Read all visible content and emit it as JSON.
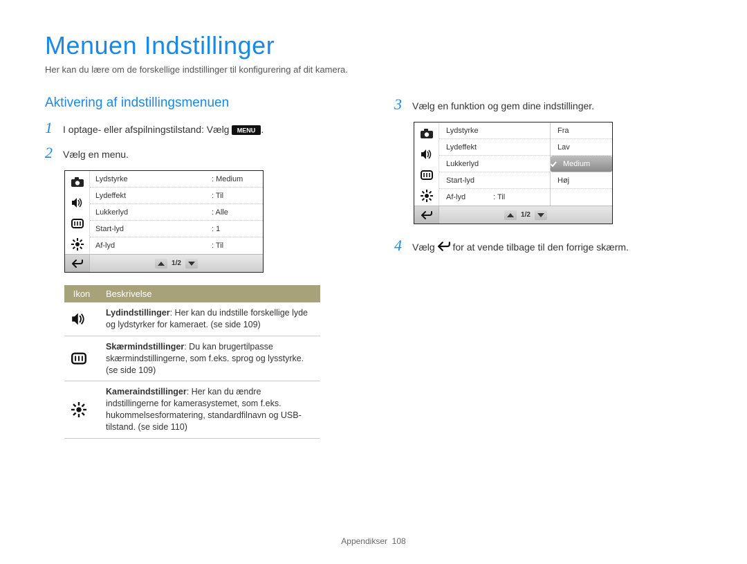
{
  "title": "Menuen Indstillinger",
  "subtitle": "Her kan du lære om de forskellige indstillinger til konfigurering af dit kamera.",
  "left": {
    "section": "Aktivering af indstillingsmenuen",
    "step1_num": "1",
    "step1_a": "I optage- eller afspilningstilstand: Vælg ",
    "step1_icon_label": "MENU",
    "step1_b": ".",
    "step2_num": "2",
    "step2": "Vælg en menu.",
    "shot1": {
      "rows": [
        {
          "k": "Lydstyrke",
          "v": ": Medium"
        },
        {
          "k": "Lydeffekt",
          "v": ": Til"
        },
        {
          "k": "Lukkerlyd",
          "v": ": Alle"
        },
        {
          "k": "Start-lyd",
          "v": ": 1"
        },
        {
          "k": "Af-lyd",
          "v": ": Til"
        }
      ],
      "page": "1/2"
    },
    "table": {
      "h_icon": "Ikon",
      "h_desc": "Beskrivelse",
      "rows": [
        {
          "bold": "Lydindstillinger",
          "rest": ": Her kan du indstille forskellige lyde og lydstyrker for kameraet. (se side 109)"
        },
        {
          "bold": "Skærmindstillinger",
          "rest": ": Du kan brugertilpasse skærmindstillingerne, som f.eks. sprog og lysstyrke. (se side 109)"
        },
        {
          "bold": "Kameraindstillinger",
          "rest": ": Her kan du ændre indstillingerne for kamerasystemet, som f.eks. hukommelsesformatering, standardfilnavn og USB-tilstand. (se side 110)"
        }
      ]
    }
  },
  "right": {
    "step3_num": "3",
    "step3": "Vælg en funktion og gem dine indstillinger.",
    "shot2": {
      "labels": [
        "Lydstyrke",
        "Lydeffekt",
        "Lukkerlyd",
        "Start-lyd",
        "Af-lyd"
      ],
      "af_lyd_val": ": Til",
      "options": [
        "Fra",
        "Lav",
        "Medium",
        "Høj"
      ],
      "selected_index": 2,
      "page": "1/2"
    },
    "step4_num": "4",
    "step4_a": "Vælg ",
    "step4_b": " for at vende tilbage til den forrige skærm."
  },
  "footer_section": "Appendikser",
  "footer_page": "108"
}
